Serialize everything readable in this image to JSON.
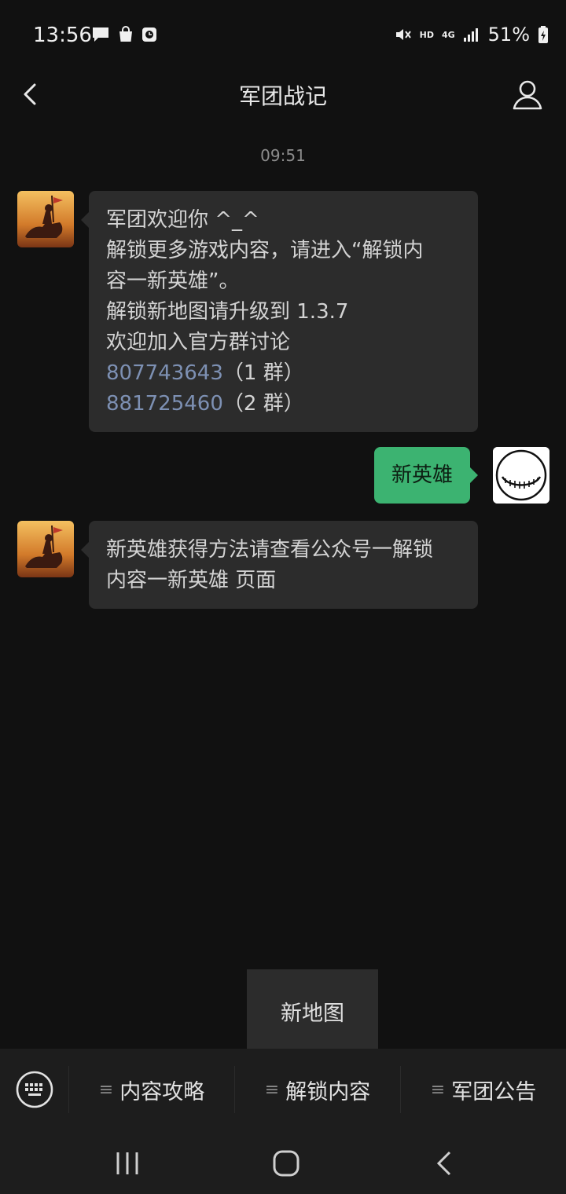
{
  "status_bar": {
    "time": "13:56",
    "battery": "51%",
    "network": "4G",
    "hd": "HD",
    "left_icons": [
      "chat-icon",
      "shopping-bag-icon",
      "clock-app-icon"
    ],
    "right_icons": [
      "mute-icon",
      "signal-icon",
      "battery-charging-icon"
    ]
  },
  "header": {
    "title": "军团战记"
  },
  "timestamp": "09:51",
  "messages": [
    {
      "sender": "official",
      "lines": [
        "军团欢迎你 ^_^",
        "解锁更多游戏内容，请进入“解锁内",
        "容一新英雄”。",
        "解锁新地图请升级到 1.3.7",
        "欢迎加入官方群讨论"
      ],
      "links": [
        {
          "number": "807743643",
          "suffix": "（1 群）"
        },
        {
          "number": "881725460",
          "suffix": "（2 群）"
        }
      ]
    },
    {
      "sender": "me",
      "text": "新英雄"
    },
    {
      "sender": "official",
      "lines": [
        "新英雄获得方法请查看公众号一解锁",
        "内容一新英雄  页面"
      ]
    }
  ],
  "popup_menu": {
    "items": [
      "新地图"
    ]
  },
  "bottom_menu": {
    "tabs": [
      "内容攻略",
      "解锁内容",
      "军团公告"
    ],
    "keyboard_icon": "keyboard-icon"
  },
  "colors": {
    "background": "#111111",
    "bubble_incoming": "#2c2c2c",
    "bubble_outgoing": "#3cb371",
    "link": "#7d90b3"
  }
}
